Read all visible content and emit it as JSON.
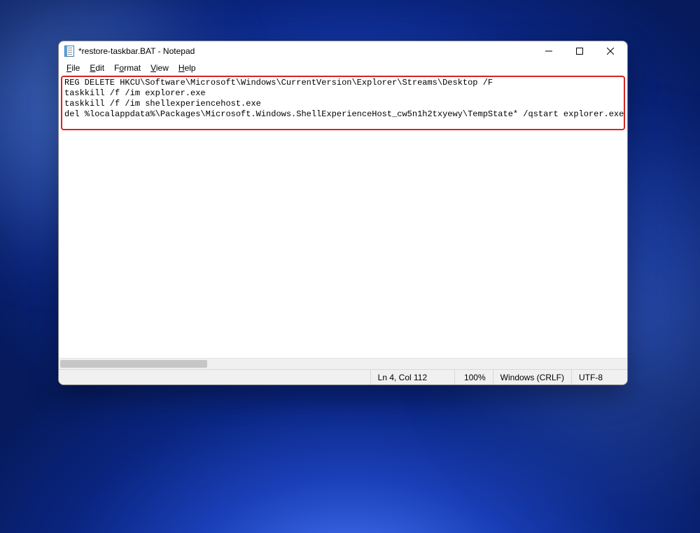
{
  "window": {
    "title": "*restore-taskbar.BAT - Notepad"
  },
  "menubar": {
    "file": "File",
    "edit": "Edit",
    "format": "Format",
    "view": "View",
    "help": "Help"
  },
  "content": {
    "lines": [
      "REG DELETE HKCU\\Software\\Microsoft\\Windows\\CurrentVersion\\Explorer\\Streams\\Desktop /F",
      "taskkill /f /im explorer.exe",
      "taskkill /f /im shellexperiencehost.exe",
      "del %localappdata%\\Packages\\Microsoft.Windows.ShellExperienceHost_cw5n1h2txyewy\\TempState* /qstart explorer.exe"
    ]
  },
  "statusbar": {
    "position": "Ln 4, Col 112",
    "zoom": "100%",
    "line_ending": "Windows (CRLF)",
    "encoding": "UTF-8"
  },
  "controls": {
    "minimize": "Minimize",
    "maximize": "Maximize",
    "close": "Close"
  }
}
